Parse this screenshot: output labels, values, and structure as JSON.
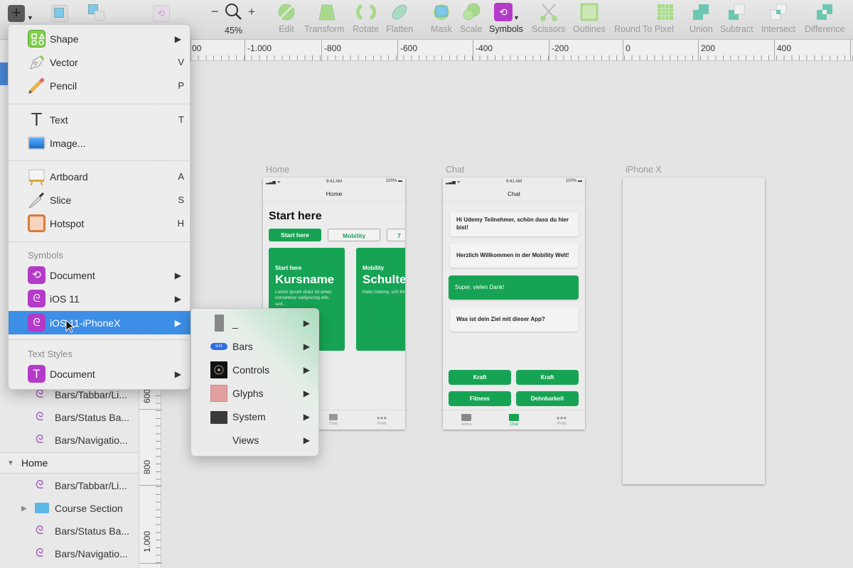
{
  "toolbar": {
    "zoom_level": "45%",
    "zoom_minus": "−",
    "zoom_plus": "+",
    "tools": [
      {
        "label": "Edit",
        "icon": "edit-icon"
      },
      {
        "label": "Transform",
        "icon": "transform-icon"
      },
      {
        "label": "Rotate",
        "icon": "rotate-icon"
      },
      {
        "label": "Flatten",
        "icon": "flatten-icon"
      },
      {
        "label": "Mask",
        "icon": "mask-icon"
      },
      {
        "label": "Scale",
        "icon": "scale-icon"
      },
      {
        "label": "Symbols",
        "icon": "symbols-icon"
      },
      {
        "label": "Scissors",
        "icon": "scissors-icon"
      },
      {
        "label": "Outlines",
        "icon": "outlines-icon"
      },
      {
        "label": "Round To Pixel",
        "icon": "round-to-pixel-icon"
      },
      {
        "label": "Union",
        "icon": "union-icon"
      },
      {
        "label": "Subtract",
        "icon": "subtract-icon"
      },
      {
        "label": "Intersect",
        "icon": "intersect-icon"
      },
      {
        "label": "Difference",
        "icon": "difference-icon"
      }
    ]
  },
  "ruler_h": [
    "00",
    "-1.000",
    "-800",
    "-600",
    "-400",
    "-200",
    "0",
    "200",
    "400"
  ],
  "ruler_v": [
    "600",
    "800",
    "1.000"
  ],
  "insert_menu": {
    "items": [
      {
        "label": "Shape",
        "shortcut": "",
        "submenu": true
      },
      {
        "label": "Vector",
        "shortcut": "V"
      },
      {
        "label": "Pencil",
        "shortcut": "P"
      },
      {
        "label": "Text",
        "shortcut": "T"
      },
      {
        "label": "Image...",
        "shortcut": ""
      },
      {
        "label": "Artboard",
        "shortcut": "A"
      },
      {
        "label": "Slice",
        "shortcut": "S"
      },
      {
        "label": "Hotspot",
        "shortcut": "H"
      }
    ],
    "symbols_header": "Symbols",
    "symbols": [
      {
        "label": "Document"
      },
      {
        "label": "iOS 11"
      },
      {
        "label": "iOS 11-iPhoneX",
        "highlighted": true
      }
    ],
    "text_styles_header": "Text Styles",
    "text_styles": [
      {
        "label": "Document"
      }
    ],
    "arrow": "▶"
  },
  "submenu": {
    "items": [
      {
        "label": "_"
      },
      {
        "label": "Bars",
        "badge": "9:41"
      },
      {
        "label": "Controls"
      },
      {
        "label": "Glyphs"
      },
      {
        "label": "System"
      },
      {
        "label": "Views"
      }
    ]
  },
  "layers": {
    "top": [
      {
        "label": "Bars/Tabbar/Li..."
      },
      {
        "label": "Bars/Status Ba..."
      },
      {
        "label": "Bars/Navigatio..."
      }
    ],
    "group": "Home",
    "home_children": [
      {
        "label": "Bars/Tabbar/Li...",
        "type": "symbol"
      },
      {
        "label": "Course Section",
        "type": "folder"
      },
      {
        "label": "Bars/Status Ba...",
        "type": "symbol"
      },
      {
        "label": "Bars/Navigatio...",
        "type": "symbol"
      }
    ]
  },
  "artboards": {
    "home": {
      "title": "Home",
      "time": "9:41 AM",
      "battery": "100%",
      "nav_title": "Home",
      "heading": "Start here",
      "chips": [
        "Start here",
        "Mobility",
        "7"
      ],
      "cards": [
        {
          "kicker": "Start here",
          "name": "Kursname",
          "desc": "Lorem ipsum dolor sit amet, consetetur sadipscing elitr, sed..."
        },
        {
          "kicker": "Mobility",
          "name": "Schulte",
          "desc": "Hallo Udemy, sch Ihr hier seid"
        }
      ],
      "tabs": [
        "Chat",
        "Profil"
      ]
    },
    "chat": {
      "title": "Chat",
      "time": "9:41 AM",
      "battery": "100%",
      "nav_title": "Chat",
      "messages": [
        {
          "text": "Hi Udemy Teilnehmer, schön dass du hier bist!",
          "mine": false
        },
        {
          "text": "Herzlich Willkommen in der Mobility Welt!",
          "mine": false
        },
        {
          "text": "Super, vielen Dank!",
          "mine": true
        },
        {
          "text": "Was ist dein Ziel mit dieser App?",
          "mine": false
        }
      ],
      "options": [
        "Kraft",
        "Kraft",
        "Fitness",
        "Dehnbarkeit"
      ],
      "tabs": [
        "Home",
        "Chat",
        "Profil"
      ]
    },
    "iphonex": {
      "title": "iPhone X"
    }
  },
  "colors": {
    "accent_green": "#16a454",
    "highlight_blue": "#3d8ee6",
    "symbol_purple": "#b43ac9"
  }
}
